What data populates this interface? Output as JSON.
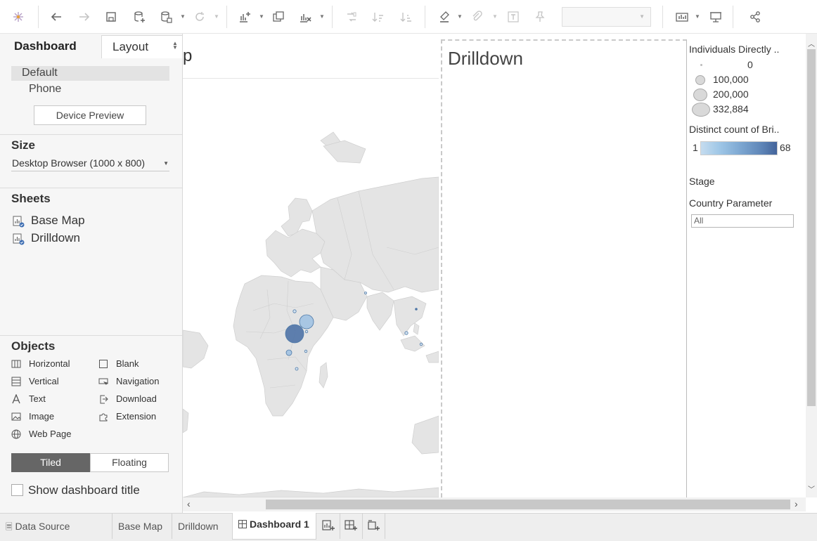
{
  "toolbar": {
    "icons": [
      "tableau-logo-icon",
      "undo-icon",
      "redo-icon",
      "save-icon",
      "new-data-source-icon",
      "pause-updates-icon",
      "refresh-icon",
      "new-worksheet-icon",
      "duplicate-sheet-icon",
      "clear-sheet-icon",
      "swap-icon",
      "sort-ascending-icon",
      "sort-descending-icon",
      "highlight-icon",
      "group-icon",
      "show-labels-icon",
      "pin-icon",
      "show-me-icon",
      "presentation-mode-icon",
      "share-icon"
    ],
    "fit_value": ""
  },
  "left_panel": {
    "tabs": {
      "dashboard": "Dashboard",
      "layout": "Layout"
    },
    "devices": {
      "default": "Default",
      "phone": "Phone"
    },
    "device_preview": "Device Preview",
    "size": {
      "heading": "Size",
      "value": "Desktop Browser (1000 x 800)"
    },
    "sheets": {
      "heading": "Sheets",
      "items": [
        "Base Map",
        "Drilldown"
      ]
    },
    "objects": {
      "heading": "Objects",
      "items": [
        {
          "label": "Horizontal",
          "icon": "horizontal-container-icon"
        },
        {
          "label": "Blank",
          "icon": "blank-icon"
        },
        {
          "label": "Vertical",
          "icon": "vertical-container-icon"
        },
        {
          "label": "Navigation",
          "icon": "navigation-icon"
        },
        {
          "label": "Text",
          "icon": "text-icon"
        },
        {
          "label": "Download",
          "icon": "download-icon"
        },
        {
          "label": "Image",
          "icon": "image-icon"
        },
        {
          "label": "Extension",
          "icon": "extension-icon"
        },
        {
          "label": "Web Page",
          "icon": "web-page-icon"
        }
      ]
    },
    "layout_toggle": {
      "tiled": "Tiled",
      "floating": "Floating",
      "selected": "Tiled"
    },
    "show_title": {
      "label": "Show dashboard title",
      "checked": false
    }
  },
  "canvas": {
    "base_map_title_fragment": "p",
    "drilldown_title": "Drilldown"
  },
  "legends": {
    "size_title": "Individuals Directly ..",
    "size_items": [
      "0",
      "100,000",
      "200,000",
      "332,884"
    ],
    "color_title": "Distinct count of Bri..",
    "color_min": "1",
    "color_max": "68",
    "stage_label": "Stage",
    "country_param_label": "Country Parameter",
    "country_param_value": "All"
  },
  "bottom_tabs": {
    "data_source": "Data Source",
    "sheets": [
      "Base Map",
      "Drilldown"
    ],
    "active": "Dashboard 1"
  },
  "colors": {
    "accent": "#4e79a7",
    "light_bubble": "#a9c7e3",
    "dark_bubble": "#4a6fa0",
    "land": "#e6e6e6",
    "selected_tab": "#666666"
  }
}
